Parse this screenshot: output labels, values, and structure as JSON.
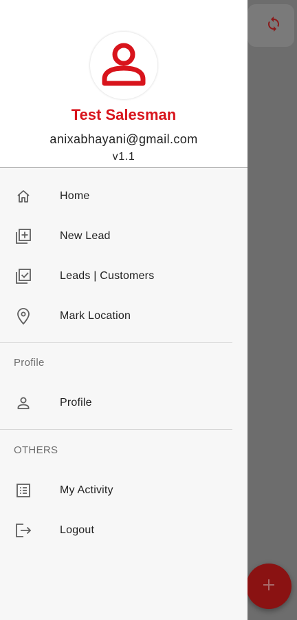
{
  "background": {
    "sync_icon": "sync-icon",
    "fab_icon": "plus-icon"
  },
  "header": {
    "avatar_icon": "person-icon",
    "name": "Test Salesman",
    "email": "anixabhayani@gmail.com",
    "version": "v1.1"
  },
  "menu": {
    "items": [
      {
        "label": "Home",
        "icon": "home-icon"
      },
      {
        "label": "New Lead",
        "icon": "add-box-icon"
      },
      {
        "label": "Leads | Customers",
        "icon": "checklist-box-icon"
      },
      {
        "label": "Mark Location",
        "icon": "location-pin-icon"
      }
    ]
  },
  "profile_section": {
    "title": "Profile",
    "items": [
      {
        "label": "Profile",
        "icon": "person-outline-icon"
      }
    ]
  },
  "others_section": {
    "title": "OTHERS",
    "items": [
      {
        "label": "My Activity",
        "icon": "list-icon"
      },
      {
        "label": "Logout",
        "icon": "logout-icon"
      }
    ]
  },
  "colors": {
    "accent": "#d8141c",
    "scrim": "#6d6d6d",
    "drawer_bg": "#f7f7f7"
  }
}
